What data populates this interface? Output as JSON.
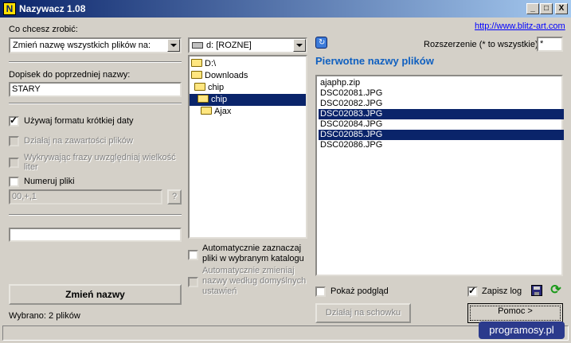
{
  "window": {
    "app_icon": "N",
    "title": "Nazywacz 1.08",
    "minimize": "_",
    "maximize": "□",
    "close": "X"
  },
  "left": {
    "action_label": "Co chcesz zrobić:",
    "action_value": "Zmień nazwę wszystkich plików na:",
    "suffix_label": "Dopisek do poprzedniej nazwy:",
    "suffix_value": "STARY",
    "short_date_label": "Używaj formatu krótkiej daty",
    "short_date_checked": true,
    "content_label": "Działaj na zawartości plików",
    "case_label": "Wykrywając frazy uwzględniaj wielkość liter",
    "number_label": "Numeruj pliki",
    "number_format": "00,+,1",
    "help_button": "?",
    "extra_value": "",
    "rename_button": "Zmień nazwy",
    "selected_status": "Wybrano: 2 plików"
  },
  "middle": {
    "drive": "d: [ROZNE]",
    "tree": [
      {
        "label": "D:\\",
        "selected": false
      },
      {
        "label": "Downloads",
        "selected": false
      },
      {
        "label": "chip",
        "selected": false
      },
      {
        "label": "chip",
        "selected": true
      },
      {
        "label": "Ajax",
        "selected": false
      }
    ],
    "auto_select_label": "Automatycznie zaznaczaj pliki w wybranym katalogu",
    "auto_rename_label": "Automatycznie zmieniaj nazwy według domyślnych ustawień"
  },
  "right": {
    "website": "http://www.blitz-art.com",
    "extension_label": "Rozszerzenie (* to wszystkie)",
    "extension_value": "*",
    "heading": "Pierwotne nazwy plików",
    "files": [
      {
        "name": "ajaphp.zip",
        "selected": false
      },
      {
        "name": "DSC02081.JPG",
        "selected": false
      },
      {
        "name": "DSC02082.JPG",
        "selected": false
      },
      {
        "name": "DSC02083.JPG",
        "selected": true
      },
      {
        "name": "DSC02084.JPG",
        "selected": false
      },
      {
        "name": "DSC02085.JPG",
        "selected": true
      },
      {
        "name": "DSC02086.JPG",
        "selected": false
      }
    ],
    "preview_label": "Pokaż podgląd",
    "save_log_label": "Zapisz log",
    "save_log_checked": true,
    "clipboard_button": "Działaj na schowku",
    "help_button": "Pomoc >"
  },
  "watermark": "programosy.pl",
  "colors": {
    "title_bar": "#0a246a",
    "selection": "#0a246a",
    "heading": "#1060c0",
    "link": "#0000ff"
  }
}
